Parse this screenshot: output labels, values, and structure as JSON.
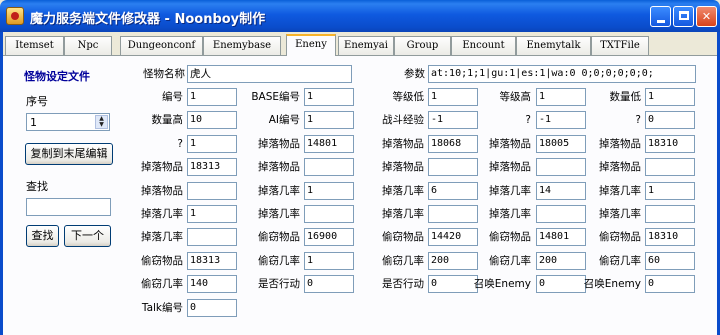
{
  "window": {
    "title": "魔力服务端文件修改器 - Noonboy制作",
    "minimize_icon": "minimize-icon",
    "maximize_icon": "maximize-icon",
    "close_icon": "close-icon"
  },
  "tabs": [
    {
      "label": "Itemset"
    },
    {
      "label": "Npc"
    },
    {
      "label": "Dungeonconf"
    },
    {
      "label": "Enemybase"
    },
    {
      "label": "Eneny"
    },
    {
      "label": "Enemyai"
    },
    {
      "label": "Group"
    },
    {
      "label": "Encount"
    },
    {
      "label": "Enemytalk"
    },
    {
      "label": "TXTFile"
    }
  ],
  "active_tab": "Eneny",
  "left_panel": {
    "title": "怪物设定文件",
    "index_label": "序号",
    "index_value": "1",
    "copy_button": "复制到末尾编辑",
    "search_label": "查找",
    "search_value": "",
    "find_button": "查找",
    "next_button": "下一个"
  },
  "form": {
    "name_label": "怪物名称",
    "name_value": "虎人",
    "params_label": "参数",
    "params_value": "at:10;1;1|gu:1|es:1|wa:0 0;0;0;0;0;0;",
    "rows": [
      [
        [
          "编号",
          "1"
        ],
        [
          "BASE编号",
          "1"
        ],
        [
          "等级低",
          "1"
        ],
        [
          "等级高",
          "1"
        ],
        [
          "数量低",
          "1"
        ]
      ],
      [
        [
          "数量高",
          "10"
        ],
        [
          "AI编号",
          "1"
        ],
        [
          "战斗经验",
          "-1"
        ],
        [
          "?",
          "-1"
        ],
        [
          "?",
          "0"
        ]
      ],
      [
        [
          "?",
          "1"
        ],
        [
          "掉落物品",
          "14801"
        ],
        [
          "掉落物品",
          "18068"
        ],
        [
          "掉落物品",
          "18005"
        ],
        [
          "掉落物品",
          "18310"
        ]
      ],
      [
        [
          "掉落物品",
          "18313"
        ],
        [
          "掉落物品",
          ""
        ],
        [
          "掉落物品",
          ""
        ],
        [
          "掉落物品",
          ""
        ],
        [
          "掉落物品",
          ""
        ]
      ],
      [
        [
          "掉落物品",
          ""
        ],
        [
          "掉落几率",
          "1"
        ],
        [
          "掉落几率",
          "6"
        ],
        [
          "掉落几率",
          "14"
        ],
        [
          "掉落几率",
          "1"
        ]
      ],
      [
        [
          "掉落几率",
          "1"
        ],
        [
          "掉落几率",
          ""
        ],
        [
          "掉落几率",
          ""
        ],
        [
          "掉落几率",
          ""
        ],
        [
          "掉落几率",
          ""
        ]
      ],
      [
        [
          "掉落几率",
          ""
        ],
        [
          "偷窃物品",
          "16900"
        ],
        [
          "偷窃物品",
          "14420"
        ],
        [
          "偷窃物品",
          "14801"
        ],
        [
          "偷窃物品",
          "18310"
        ]
      ],
      [
        [
          "偷窃物品",
          "18313"
        ],
        [
          "偷窃几率",
          "1"
        ],
        [
          "偷窃几率",
          "200"
        ],
        [
          "偷窃几率",
          "200"
        ],
        [
          "偷窃几率",
          "60"
        ]
      ],
      [
        [
          "偷窃几率",
          "140"
        ],
        [
          "是否行动",
          "0"
        ],
        [
          "是否行动",
          "0"
        ],
        [
          "召唤Enemy",
          "0"
        ],
        [
          "召唤Enemy",
          "0"
        ]
      ],
      [
        [
          "Talk编号",
          "0"
        ]
      ]
    ]
  }
}
